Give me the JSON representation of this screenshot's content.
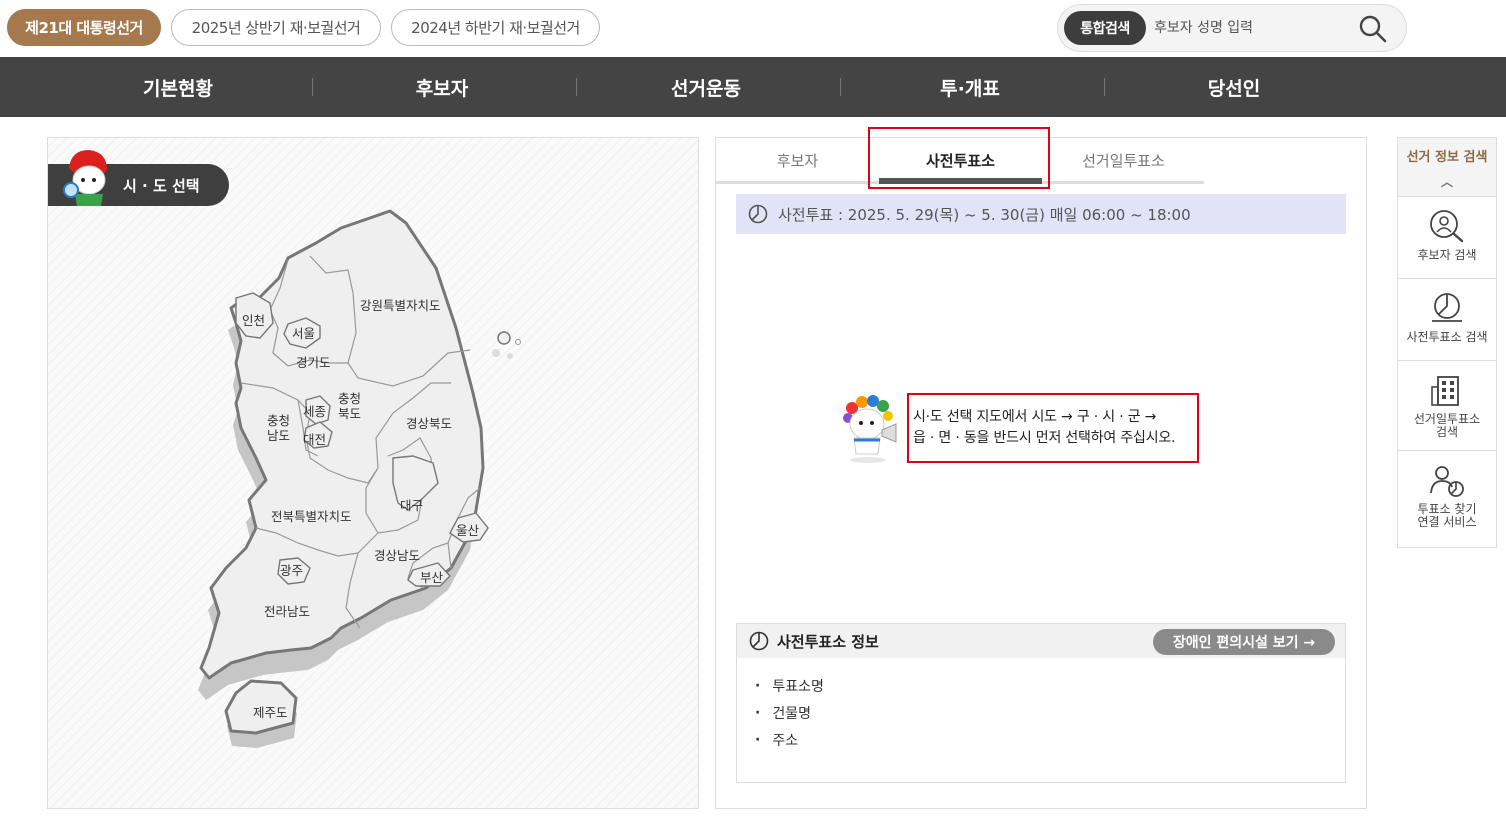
{
  "election_tabs": [
    {
      "label": "제21대 대통령선거",
      "active": true
    },
    {
      "label": "2025년 상반기 재·보궐선거",
      "active": false
    },
    {
      "label": "2024년 하반기 재·보궐선거",
      "active": false
    }
  ],
  "search": {
    "button_label": "통합검색",
    "placeholder": "후보자 성명 입력"
  },
  "nav": [
    "기본현황",
    "후보자",
    "선거운동",
    "투·개표",
    "당선인"
  ],
  "map": {
    "title": "시 · 도 선택",
    "regions": [
      "인천",
      "서울",
      "경기도",
      "강원특별자치도",
      "충청남도",
      "세종",
      "충청북도",
      "대전",
      "경상북도",
      "대구",
      "전북특별자치도",
      "울산",
      "경상남도",
      "광주",
      "부산",
      "전라남도",
      "제주도"
    ]
  },
  "tabs": [
    {
      "label": "후보자",
      "active": false
    },
    {
      "label": "사전투표소",
      "active": true
    },
    {
      "label": "선거일투표소",
      "active": false
    }
  ],
  "notice": "사전투표 : 2025. 5. 29(목) ~ 5. 30(금) 매일 06:00 ~ 18:00",
  "guide": {
    "line1": "시·도 선택 지도에서 시도 → 구 · 시 · 군 →",
    "line2": "읍 · 면 · 동을 반드시 먼저 선택하여 주십시오."
  },
  "info": {
    "title": "사전투표소 정보",
    "facility_button": "장애인 편의시설 보기  →",
    "fields": [
      "투표소명",
      "건물명",
      "주소"
    ]
  },
  "side": {
    "title": "선거 정보 검색",
    "items": [
      {
        "label_1": "후보자 검색",
        "label_2": "",
        "icon": "person-search-icon"
      },
      {
        "label_1": "사전투표소 검색",
        "label_2": "",
        "icon": "ballot-search-icon"
      },
      {
        "label_1": "선거일투표소",
        "label_2": "검색",
        "icon": "building-icon"
      },
      {
        "label_1": "투표소 찾기",
        "label_2": "연결 서비스",
        "icon": "person-location-icon"
      }
    ]
  },
  "colors": {
    "active_tab": "#a5784d",
    "nav_bg": "#444444",
    "highlight": "#e0001a",
    "notice_bg": "#e3e3f7"
  }
}
